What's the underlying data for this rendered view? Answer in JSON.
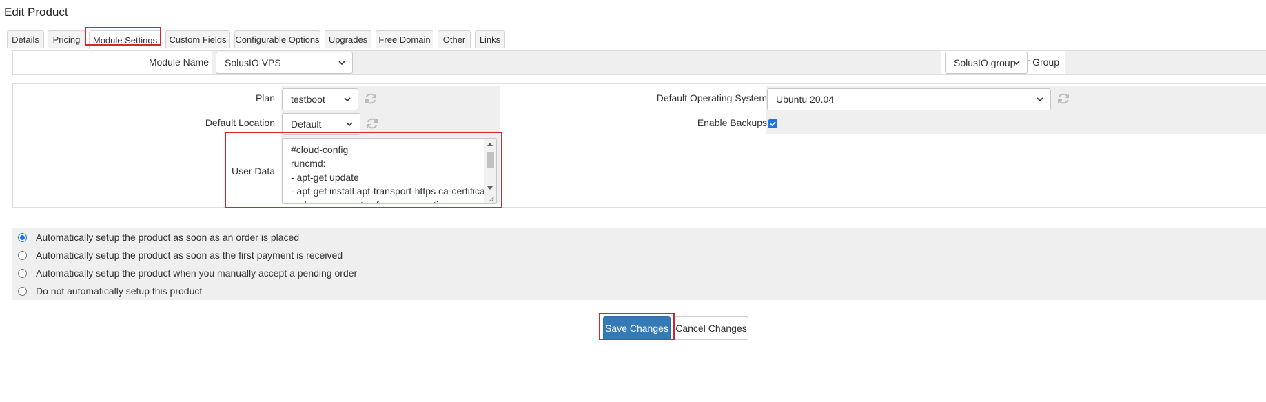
{
  "page": {
    "title": "Edit Product"
  },
  "tabs": [
    {
      "label": "Details"
    },
    {
      "label": "Pricing"
    },
    {
      "label": "Module Settings",
      "active": true
    },
    {
      "label": "Custom Fields"
    },
    {
      "label": "Configurable Options"
    },
    {
      "label": "Upgrades"
    },
    {
      "label": "Free Domain"
    },
    {
      "label": "Other"
    },
    {
      "label": "Links"
    }
  ],
  "module": {
    "module_name_label": "Module Name",
    "module_name_value": "SolusIO VPS",
    "server_group_label": "Server Group",
    "server_group_value": "SolusIO group"
  },
  "settings": {
    "plan_label": "Plan",
    "plan_value": "testboot",
    "default_location_label": "Default Location",
    "default_location_value": "Default",
    "user_data_label": "User Data",
    "user_data_lines": [
      "#cloud-config",
      "runcmd:",
      "- apt-get update",
      "- apt-get install apt-transport-https ca-certificates",
      "curl gnupg-agent software-properties-common -y"
    ],
    "default_os_label": "Default Operating System",
    "default_os_value": "Ubuntu 20.04",
    "enable_backups_label": "Enable Backups",
    "enable_backups_checked": true
  },
  "setup_options": [
    {
      "label": "Automatically setup the product as soon as an order is placed",
      "checked": true
    },
    {
      "label": "Automatically setup the product as soon as the first payment is received",
      "checked": false
    },
    {
      "label": "Automatically setup the product when you manually accept a pending order",
      "checked": false
    },
    {
      "label": "Do not automatically setup this product",
      "checked": false
    }
  ],
  "buttons": {
    "save_label": "Save Changes",
    "cancel_label": "Cancel Changes"
  },
  "colors": {
    "accent": "#337ab7",
    "highlight": "#d9242b",
    "checkbox": "#1a73e8"
  }
}
